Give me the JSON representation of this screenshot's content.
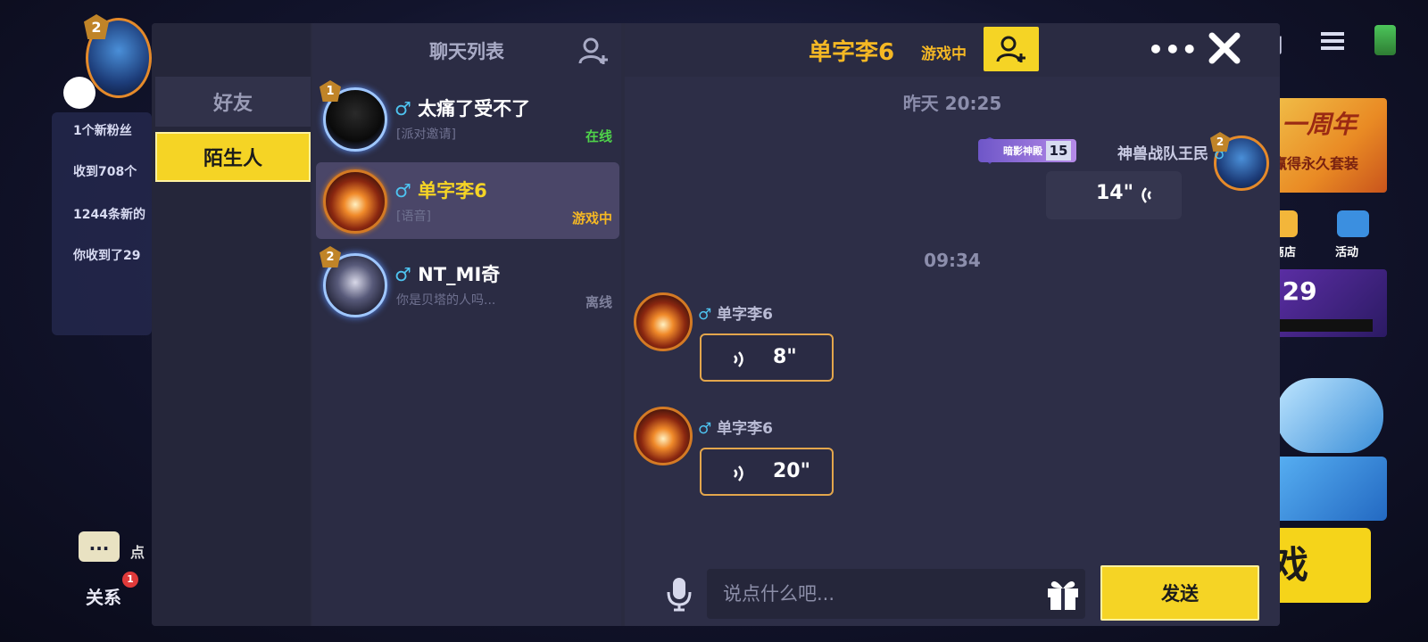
{
  "background": {
    "level": "2",
    "notifications": [
      "1个新粉丝",
      "收到708个",
      "1244条新的",
      "你收到了29"
    ],
    "chat_icon_text": "...",
    "dian_text": "点",
    "relation_label": "关系",
    "relation_badge": "1",
    "right_cut_text": "们",
    "banner1_title": "一周年",
    "banner1_sub": "赢得永久套装",
    "shop_label": "商店",
    "activity_label": "活动",
    "banner2_number": ".29",
    "play_text": "戏"
  },
  "categories": {
    "friends_label": "好友",
    "strangers_label": "陌生人"
  },
  "chat_list": {
    "title": "聊天列表",
    "conversations": [
      {
        "level": "1",
        "gender": "♂",
        "name": "太痛了受不了",
        "preview": "[派对邀请]",
        "status": "在线"
      },
      {
        "gender": "♂",
        "name": "单字李6",
        "preview": "[语音]",
        "status": "游戏中"
      },
      {
        "level": "2",
        "gender": "♂",
        "name": "NT_MI奇",
        "preview": "你是贝塔的人吗...",
        "status": "离线"
      }
    ]
  },
  "chat": {
    "title": "单字李6",
    "title_status": "游戏中",
    "more_label": "•••",
    "messages": {
      "timestamp1": "昨天 20:25",
      "my_clan_badge": "暗影神殿",
      "my_clan_level": "15",
      "my_name": "神兽战队王民",
      "my_gender": "♂",
      "my_level": "2",
      "my_voice_length": "14\"",
      "timestamp2": "09:34",
      "other_gender": "♂",
      "other_name": "单字李6",
      "voice1_length": "8\"",
      "voice2_length": "20\""
    },
    "input_placeholder": "说点什么吧...",
    "send_label": "发送"
  },
  "colors": {
    "accent_yellow": "#f5d425",
    "status_online": "#4fd34a",
    "status_ingame": "#f5b824",
    "gender_male": "#4ec3f0"
  }
}
